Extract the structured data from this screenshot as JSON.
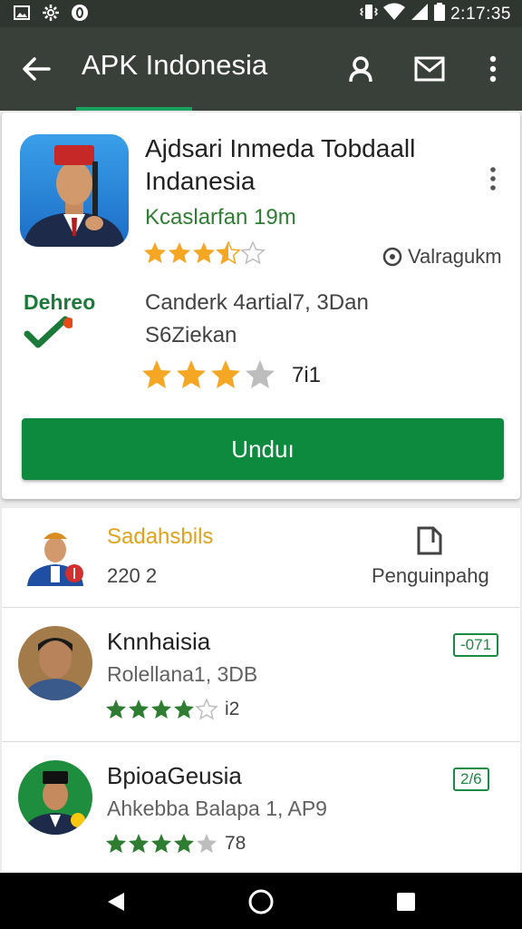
{
  "status_bar": {
    "time": "2:17:35"
  },
  "app_bar": {
    "title": "APK Indonesia"
  },
  "app_card": {
    "title": "Ajdsari Inmeda Tobdaall Indanesia",
    "developer": "Kcaslarfan 19m",
    "stars": 3.5,
    "verified_label": "Valragukm",
    "verified_word": "Dehreo",
    "info_line1": "Canderk 4artial7, 3Dan",
    "info_line2": "S6Ziekan",
    "rating_stars": 3,
    "rating_count": "7i1",
    "download_label": "Unduı"
  },
  "list": {
    "featured": {
      "name": "Sadahsbils",
      "sub": "220 2",
      "action_label": "Penguinpahg"
    },
    "items": [
      {
        "name": "Knnhaisia",
        "sub": "Rolellana1, 3DB",
        "stars": 4,
        "count": "i2",
        "badge": "-071"
      },
      {
        "name": "BpioaGeusia",
        "sub": "Ahkebba Balapa 1, AP9",
        "stars": 4,
        "count": "78",
        "badge": "2/6"
      }
    ]
  },
  "colors": {
    "accent": "#0e8a3e",
    "star_gold": "#f5a623",
    "star_green": "#2e7d32",
    "app_bar": "#39403a"
  }
}
